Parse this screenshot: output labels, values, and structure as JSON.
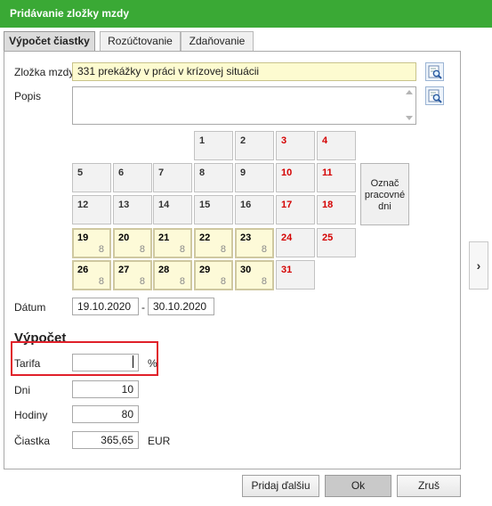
{
  "window": {
    "title": "Pridávanie zložky mzdy"
  },
  "tabs": [
    {
      "label": "Výpočet čiastky"
    },
    {
      "label": "Rozúčtovanie"
    },
    {
      "label": "Zdaňovanie"
    }
  ],
  "form": {
    "zlozka_label": "Zložka mzdy",
    "zlozka_value": "331  prekážky v práci v krízovej situácii",
    "popis_label": "Popis",
    "popis_value": ""
  },
  "calendar": {
    "mark_button": "Označ pracovné dni",
    "days": [
      {
        "day": "1"
      },
      {
        "day": "2"
      },
      {
        "day": "3",
        "weekend": true
      },
      {
        "day": "4",
        "weekend": true
      },
      {
        "day": "5"
      },
      {
        "day": "6"
      },
      {
        "day": "7"
      },
      {
        "day": "8"
      },
      {
        "day": "9"
      },
      {
        "day": "10",
        "weekend": true
      },
      {
        "day": "11",
        "weekend": true
      },
      {
        "day": "12"
      },
      {
        "day": "13"
      },
      {
        "day": "14"
      },
      {
        "day": "15"
      },
      {
        "day": "16"
      },
      {
        "day": "17",
        "weekend": true
      },
      {
        "day": "18",
        "weekend": true
      },
      {
        "day": "19",
        "hours": "8",
        "selected": true
      },
      {
        "day": "20",
        "hours": "8",
        "selected": true
      },
      {
        "day": "21",
        "hours": "8",
        "selected": true
      },
      {
        "day": "22",
        "hours": "8",
        "selected": true
      },
      {
        "day": "23",
        "hours": "8",
        "selected": true
      },
      {
        "day": "24",
        "weekend": true
      },
      {
        "day": "25",
        "weekend": true
      },
      {
        "day": "26",
        "hours": "8",
        "selected": true
      },
      {
        "day": "27",
        "hours": "8",
        "selected": true
      },
      {
        "day": "28",
        "hours": "8",
        "selected": true
      },
      {
        "day": "29",
        "hours": "8",
        "selected": true
      },
      {
        "day": "30",
        "hours": "8",
        "selected": true
      },
      {
        "day": "31",
        "weekend": true
      }
    ]
  },
  "datum": {
    "label": "Dátum",
    "from": "19.10.2020",
    "separator": "-",
    "to": "30.10.2020"
  },
  "vypocet": {
    "heading": "Výpočet",
    "tarifa_label": "Tarifa",
    "tarifa_value": "",
    "tarifa_unit": "%",
    "dni_label": "Dni",
    "dni_value": "10",
    "hodiny_label": "Hodiny",
    "hodiny_value": "80",
    "ciastka_label": "Čiastka",
    "ciastka_value": "365,65",
    "ciastka_unit": "EUR"
  },
  "buttons": {
    "add_next": "Pridaj ďalšiu",
    "ok": "Ok",
    "cancel": "Zruš"
  },
  "icons": {
    "lookup": "search-lookup-icon",
    "side": "chevron-right-icon"
  },
  "colors": {
    "titlebar": "#3aa935",
    "weekend": "#d40000",
    "highlight": "#e0202a"
  }
}
